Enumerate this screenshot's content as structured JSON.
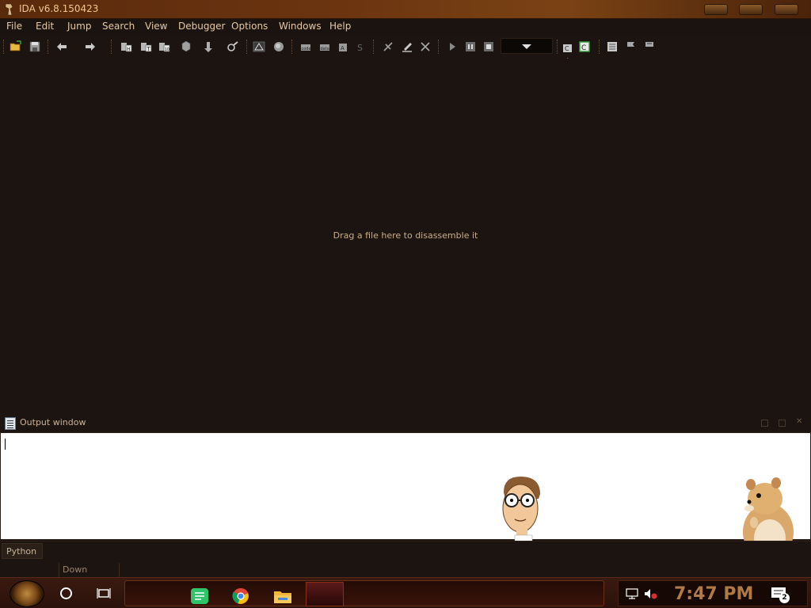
{
  "window": {
    "title": "IDA v6.8.150423"
  },
  "menu": [
    "File",
    "Edit",
    "Jump",
    "Search",
    "View",
    "Debugger",
    "Options",
    "Windows",
    "Help"
  ],
  "toolbar": {
    "icons": [
      "open-icon",
      "save-icon",
      "back-icon",
      "forward-icon",
      "hex-view-icon",
      "text-view-icon",
      "graph-view-icon",
      "struct-icon",
      "jump-icon",
      "search-icon",
      "debug-warning-icon",
      "record-icon",
      "code-icon",
      "data-icon",
      "string-icon",
      "undefine-icon",
      "patch-icon",
      "edit-icon",
      "delete-icon",
      "run-icon",
      "pause-icon",
      "stop-icon",
      "debugger-select-icon",
      "cursor-icon",
      "log-icon",
      "breakpoint-icon",
      "flags-icon"
    ],
    "debugger_selected": ""
  },
  "workspace": {
    "hint": "Drag a file here to disassemble it"
  },
  "output": {
    "title": "Output window",
    "content": ""
  },
  "python_button": "Python",
  "status": {
    "direction": "Down"
  },
  "taskbar": {
    "clock": "7:47 PM",
    "notifications": "2"
  },
  "colors": {
    "background": "#1c1410",
    "accent": "#e6c9a4",
    "title_bar": "#6b3410"
  }
}
